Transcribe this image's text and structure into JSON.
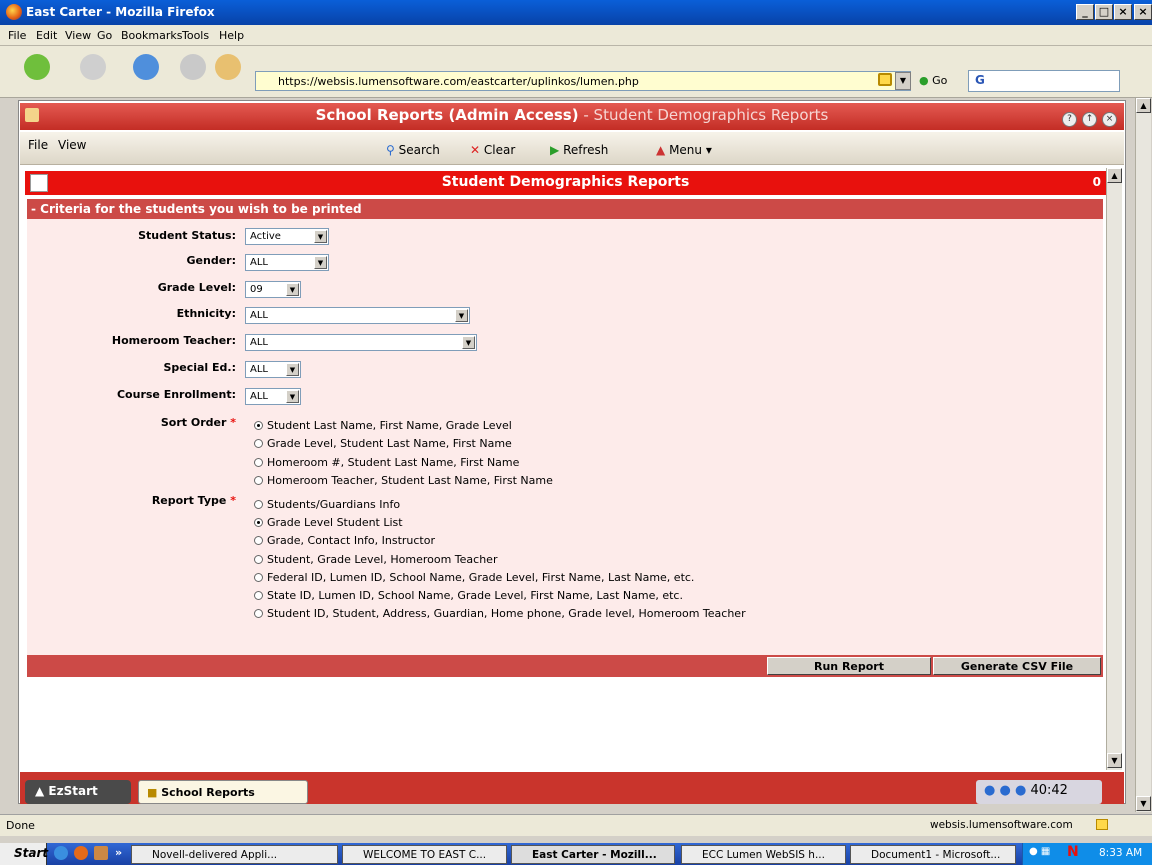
{
  "window": {
    "title": "East Carter - Mozilla Firefox",
    "controls": [
      "_",
      "□",
      "×"
    ]
  },
  "menu": [
    "File",
    "Edit",
    "View",
    "Go",
    "Bookmarks",
    "Tools",
    "Help"
  ],
  "nav": {
    "url": "https://websis.lumensoftware.com/eastcarter/uplinkos/lumen.php",
    "go_label": "Go",
    "search_value": "G"
  },
  "app": {
    "title_bold": "School Reports (Admin Access)",
    "title_rest": " - Student Demographics Reports",
    "menu": [
      "File",
      "View"
    ],
    "toolbar": {
      "search": "Search",
      "clear": "Clear",
      "refresh": "Refresh",
      "menu": "Menu ▾"
    }
  },
  "report": {
    "title": "Student Demographics Reports",
    "count": "0",
    "criteria_title": "- Criteria for the students you wish to be printed",
    "fields": {
      "student_status": {
        "label": "Student Status:",
        "value": "Active"
      },
      "gender": {
        "label": "Gender:",
        "value": "ALL"
      },
      "grade_level": {
        "label": "Grade Level:",
        "value": "09"
      },
      "ethnicity": {
        "label": "Ethnicity:",
        "value": "ALL"
      },
      "homeroom_teacher": {
        "label": "Homeroom Teacher:",
        "value": "ALL"
      },
      "special_ed": {
        "label": "Special Ed.:",
        "value": "ALL"
      },
      "course_enrollment": {
        "label": "Course Enrollment:",
        "value": "ALL"
      }
    },
    "sort_order": {
      "label": "Sort Order",
      "required": "*",
      "options": [
        "Student Last Name, First Name, Grade Level",
        "Grade Level, Student Last Name, First Name",
        "Homeroom #, Student Last Name, First Name",
        "Homeroom Teacher, Student Last Name, First Name"
      ],
      "selected": 0
    },
    "report_type": {
      "label": "Report Type",
      "required": "*",
      "options": [
        "Students/Guardians Info",
        "Grade Level Student List",
        "Grade, Contact Info, Instructor",
        "Student, Grade Level, Homeroom Teacher",
        "Federal ID, Lumen ID, School Name, Grade Level, First Name, Last Name, etc.",
        "State ID, Lumen ID, School Name, Grade Level, First Name, Last Name, etc.",
        "Student ID, Student, Address, Guardian, Home phone, Grade level, Homeroom Teacher"
      ],
      "selected": 1
    },
    "run_label": "Run Report",
    "csv_label": "Generate CSV File"
  },
  "appbar": {
    "ezstart": "EzStart",
    "school_reports": "School Reports",
    "clock": "40:42"
  },
  "status": {
    "text": "Done",
    "host": "websis.lumensoftware.com"
  },
  "taskbar": {
    "start": "Start",
    "tasks": [
      "Novell-delivered Appli...",
      "WELCOME TO EAST C...",
      "East Carter - Mozill...",
      "ECC Lumen WebSIS h...",
      "Document1 - Microsoft..."
    ],
    "time": "8:33 AM"
  }
}
